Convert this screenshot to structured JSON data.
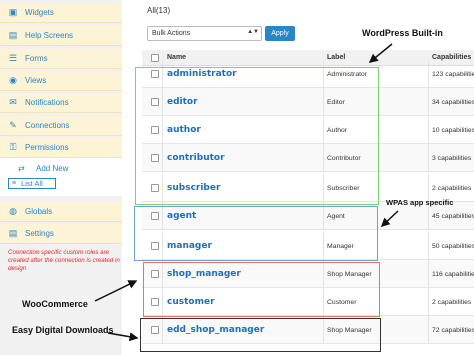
{
  "sidebar": {
    "items": [
      {
        "label": "Widgets",
        "icon": "widgets-icon",
        "glyph": "▣"
      },
      {
        "label": "Help Screens",
        "icon": "help-icon",
        "glyph": "▤"
      },
      {
        "label": "Forms",
        "icon": "forms-icon",
        "glyph": "☰"
      },
      {
        "label": "Views",
        "icon": "views-icon",
        "glyph": "◉"
      },
      {
        "label": "Notifications",
        "icon": "notifications-icon",
        "glyph": "✉"
      },
      {
        "label": "Connections",
        "icon": "connections-icon",
        "glyph": "✎"
      },
      {
        "label": "Permissions",
        "icon": "permissions-icon",
        "glyph": "⚿"
      }
    ],
    "sub_items": [
      {
        "label": "Add New",
        "icon": "add-icon",
        "glyph": "⇄"
      },
      {
        "label": "List All",
        "icon": "list-icon",
        "glyph": "≡"
      }
    ],
    "bottom_items": [
      {
        "label": "Globals",
        "icon": "globals-icon",
        "glyph": "◍"
      },
      {
        "label": "Settings",
        "icon": "settings-icon",
        "glyph": "▤"
      }
    ],
    "note": "Connection specific custom roles are created after the connection is created in design"
  },
  "main": {
    "count": "All(13)",
    "bulk_actions": "Bulk Actions",
    "apply_label": "Apply",
    "columns": {
      "name": "Name",
      "label": "Label",
      "capabilities": "Capabilities"
    },
    "rows": [
      {
        "name": "administrator",
        "label": "Administrator",
        "caps": "123 capabilities"
      },
      {
        "name": "editor",
        "label": "Editor",
        "caps": "34 capabilities"
      },
      {
        "name": "author",
        "label": "Author",
        "caps": "10 capabilities"
      },
      {
        "name": "contributor",
        "label": "Contributor",
        "caps": "3 capabilities"
      },
      {
        "name": "subscriber",
        "label": "Subscriber",
        "caps": "2 capabilities"
      },
      {
        "name": "agent",
        "label": "Agent",
        "caps": "45 capabilities"
      },
      {
        "name": "manager",
        "label": "Manager",
        "caps": "50 capabilities"
      },
      {
        "name": "shop_manager",
        "label": "Shop Manager",
        "caps": "116 capabilities"
      },
      {
        "name": "customer",
        "label": "Customer",
        "caps": "2 capabilities"
      },
      {
        "name": "edd_shop_manager",
        "label": "Shop Manager",
        "caps": "72 capabilities"
      }
    ]
  },
  "annotations": {
    "wordpress": "WordPress Built-in",
    "wpas": "WPAS app specific",
    "woocommerce": "WooCommerce",
    "edd": "Easy Digital Downloads"
  },
  "colors": {
    "green": "#7ed36a",
    "blue": "#6fa0e0",
    "red": "#e8745e",
    "black": "#333333",
    "link": "#1e6ec0",
    "accent": "#2a86c4"
  }
}
